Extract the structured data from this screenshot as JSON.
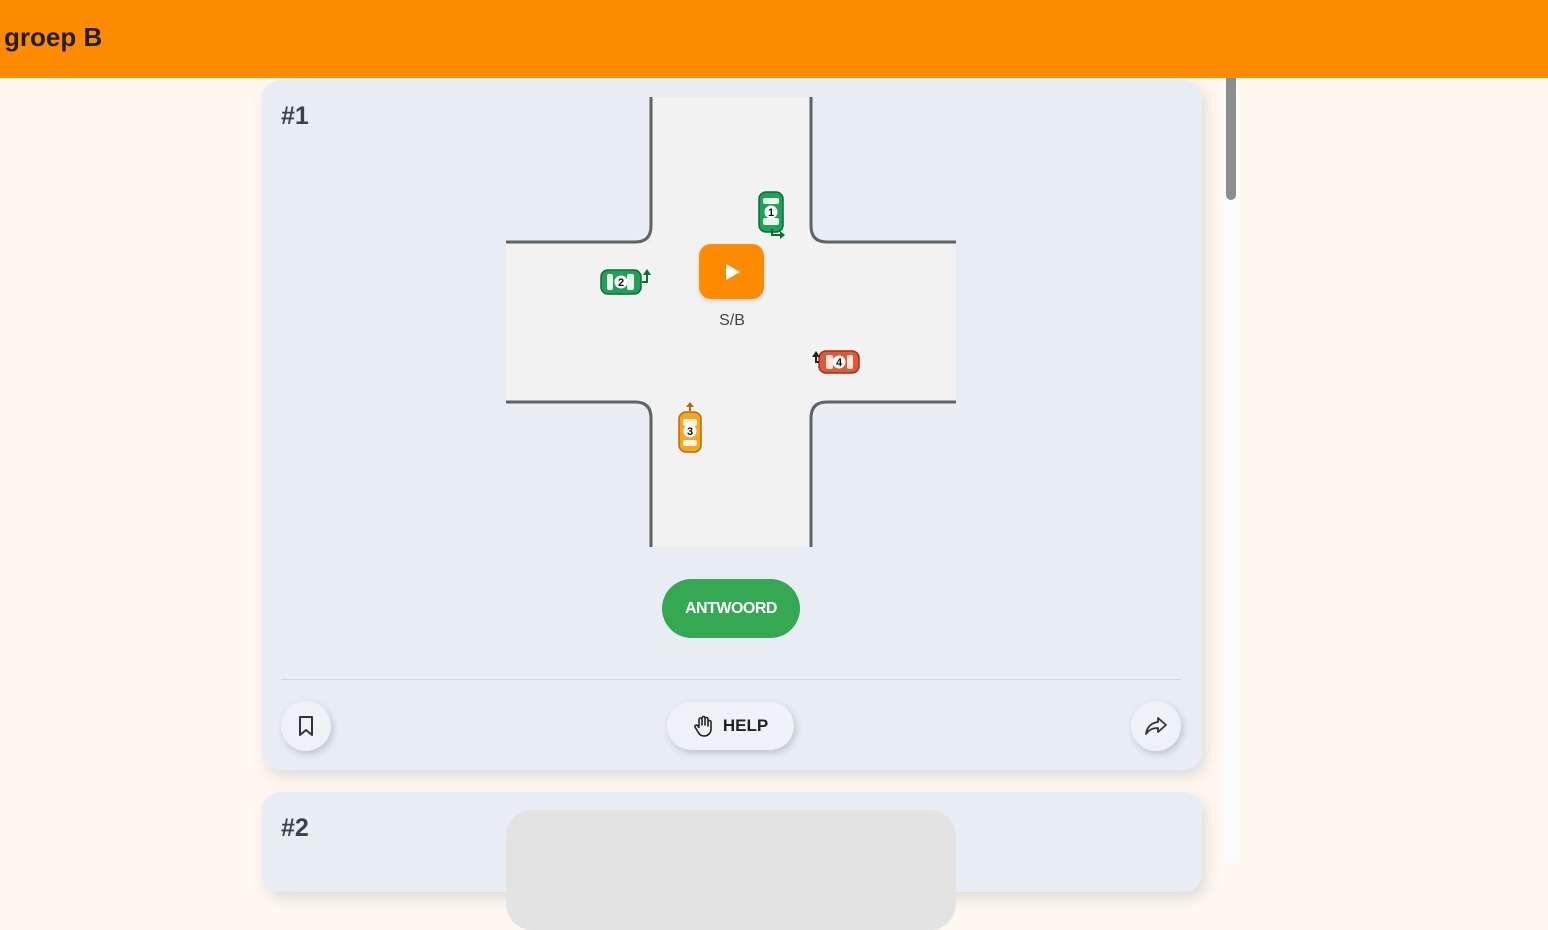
{
  "header": {
    "title": "groep B"
  },
  "colors": {
    "accent": "#ff8b00",
    "answer": "#34a853",
    "car_green": "#1ea25a",
    "car_red": "#e05a3a",
    "car_orange": "#f5a623"
  },
  "cards": [
    {
      "number": "#1",
      "play_icon": "play-icon",
      "priority_label": "S/B",
      "cars": [
        {
          "number": "1",
          "color": "green",
          "maneuver": "turn-left"
        },
        {
          "number": "2",
          "color": "green",
          "maneuver": "turn-left"
        },
        {
          "number": "3",
          "color": "orange",
          "maneuver": "straight"
        },
        {
          "number": "4",
          "color": "red",
          "maneuver": "turn-right"
        }
      ],
      "answer_label": "ANTWOORD",
      "help_label": "HELP",
      "bookmark_icon": "bookmark-icon",
      "share_icon": "share-icon",
      "help_icon": "hand-icon"
    },
    {
      "number": "#2"
    }
  ]
}
